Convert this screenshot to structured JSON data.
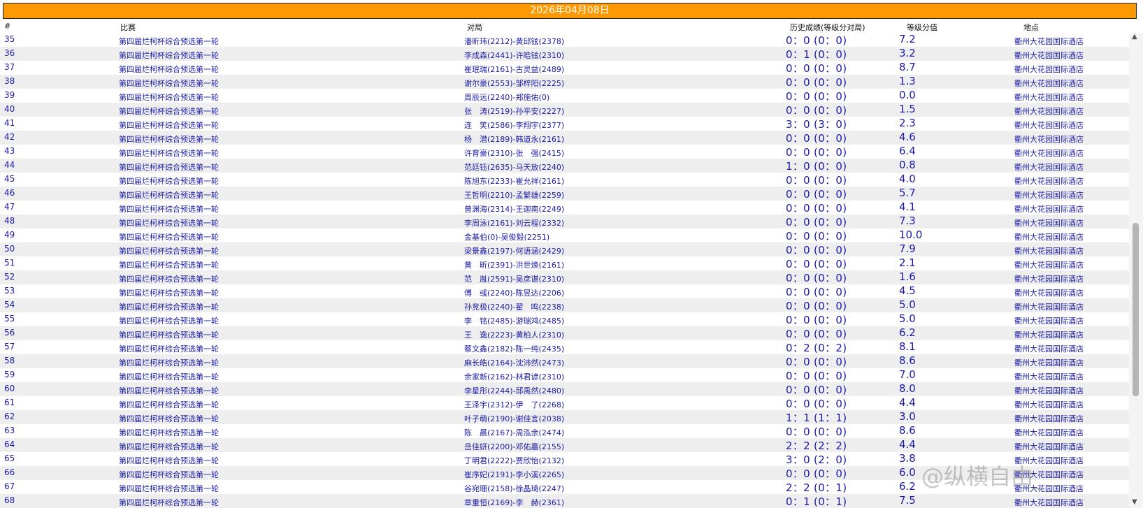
{
  "banner": {
    "date": "2026年04月08日"
  },
  "header": {
    "num": "#",
    "event": "比赛",
    "match": "对局",
    "history": "历史成绩(等级分对局)",
    "level": "等级分值",
    "venue": "地点"
  },
  "rows": [
    {
      "num": "35",
      "event": "第四届烂柯杯综合预选第一轮",
      "match": "潘昕玮(2212)-黄邱铉(2378)",
      "history": "0：0 (0：0)",
      "level": "7.2",
      "venue": "衢州大花园国际酒店"
    },
    {
      "num": "36",
      "event": "第四届烂柯杯综合预选第一轮",
      "match": "李成森(2441)-许皓铉(2310)",
      "history": "0：1 (0：0)",
      "level": "3.2",
      "venue": "衢州大花园国际酒店"
    },
    {
      "num": "37",
      "event": "第四届烂柯杯综合预选第一轮",
      "match": "崔珉瑞(2161)-古灵益(2489)",
      "history": "0：0 (0：0)",
      "level": "8.7",
      "venue": "衢州大花园国际酒店"
    },
    {
      "num": "38",
      "event": "第四届烂柯杯综合预选第一轮",
      "match": "谢尔豪(2553)-邹梓阳(2225)",
      "history": "0：0 (0：0)",
      "level": "1.3",
      "venue": "衢州大花园国际酒店"
    },
    {
      "num": "39",
      "event": "第四届烂柯杯综合预选第一轮",
      "match": "周辰远(2240)-郑施佑(0)",
      "history": "0：0 (0：0)",
      "level": "0.0",
      "venue": "衢州大花园国际酒店"
    },
    {
      "num": "40",
      "event": "第四届烂柯杯综合预选第一轮",
      "match": "张　涛(2519)-孙平安(2227)",
      "history": "0：0 (0：0)",
      "level": "1.5",
      "venue": "衢州大花园国际酒店"
    },
    {
      "num": "41",
      "event": "第四届烂柯杯综合预选第一轮",
      "match": "连　笑(2586)-李翔宇(2377)",
      "history": "3：0 (3：0)",
      "level": "2.3",
      "venue": "衢州大花园国际酒店"
    },
    {
      "num": "42",
      "event": "第四届烂柯杯综合预选第一轮",
      "match": "杨　潜(2189)-韩道永(2161)",
      "history": "0：0 (0：0)",
      "level": "4.6",
      "venue": "衢州大花园国际酒店"
    },
    {
      "num": "43",
      "event": "第四届烂柯杯综合预选第一轮",
      "match": "许育豪(2310)-张　强(2415)",
      "history": "0：0 (0：0)",
      "level": "6.4",
      "venue": "衢州大花园国际酒店"
    },
    {
      "num": "44",
      "event": "第四届烂柯杯综合预选第一轮",
      "match": "范廷钰(2635)-马天放(2240)",
      "history": "1：0 (0：0)",
      "level": "0.8",
      "venue": "衢州大花园国际酒店"
    },
    {
      "num": "45",
      "event": "第四届烂柯杯综合预选第一轮",
      "match": "陈旭东(2233)-崔允祥(2161)",
      "history": "0：0 (0：0)",
      "level": "4.0",
      "venue": "衢州大花园国际酒店"
    },
    {
      "num": "46",
      "event": "第四届烂柯杯综合预选第一轮",
      "match": "王哲明(2210)-孟繁雄(2259)",
      "history": "0：0 (0：0)",
      "level": "5.7",
      "venue": "衢州大花园国际酒店"
    },
    {
      "num": "47",
      "event": "第四届烂柯杯综合预选第一轮",
      "match": "曾渊海(2314)-王迦南(2249)",
      "history": "0：0 (0：0)",
      "level": "4.1",
      "venue": "衢州大花园国际酒店"
    },
    {
      "num": "48",
      "event": "第四届烂柯杯综合预选第一轮",
      "match": "李周泳(2161)-刘云程(2332)",
      "history": "0：0 (0：0)",
      "level": "7.3",
      "venue": "衢州大花园国际酒店"
    },
    {
      "num": "49",
      "event": "第四届烂柯杯综合预选第一轮",
      "match": "金基伯(0)-吴俊毅(2251)",
      "history": "0：0 (0：0)",
      "level": "10.0",
      "venue": "衢州大花园国际酒店"
    },
    {
      "num": "50",
      "event": "第四届烂柯杯综合预选第一轮",
      "match": "梁景鑫(2197)-何语涵(2429)",
      "history": "0：0 (0：0)",
      "level": "7.9",
      "venue": "衢州大花园国际酒店"
    },
    {
      "num": "51",
      "event": "第四届烂柯杯综合预选第一轮",
      "match": "黄　昕(2391)-洪世焕(2161)",
      "history": "0：0 (0：0)",
      "level": "2.1",
      "venue": "衢州大花园国际酒店"
    },
    {
      "num": "52",
      "event": "第四届烂柯杯综合预选第一轮",
      "match": "范　胤(2591)-吴彦谌(2310)",
      "history": "0：0 (0：0)",
      "level": "1.6",
      "venue": "衢州大花园国际酒店"
    },
    {
      "num": "53",
      "event": "第四届烂柯杯综合预选第一轮",
      "match": "傅　彧(2240)-陈昱达(2206)",
      "history": "0：0 (0：0)",
      "level": "4.5",
      "venue": "衢州大花园国际酒店"
    },
    {
      "num": "54",
      "event": "第四届烂柯杯综合预选第一轮",
      "match": "孙竞极(2240)-翟　鸣(2238)",
      "history": "0：0 (0：0)",
      "level": "5.0",
      "venue": "衢州大花园国际酒店"
    },
    {
      "num": "55",
      "event": "第四届烂柯杯综合预选第一轮",
      "match": "李　铭(2485)-游瑞鸿(2485)",
      "history": "0：0 (0：0)",
      "level": "5.0",
      "venue": "衢州大花园国际酒店"
    },
    {
      "num": "56",
      "event": "第四届烂柯杯综合预选第一轮",
      "match": "王　逸(2223)-黄柏人(2310)",
      "history": "0：0 (0：0)",
      "level": "6.2",
      "venue": "衢州大花园国际酒店"
    },
    {
      "num": "57",
      "event": "第四届烂柯杯综合预选第一轮",
      "match": "蔡文鑫(2182)-陈一纯(2435)",
      "history": "0：2 (0：2)",
      "level": "8.1",
      "venue": "衢州大花园国际酒店"
    },
    {
      "num": "58",
      "event": "第四届烂柯杯综合预选第一轮",
      "match": "麻长皓(2164)-沈沛然(2473)",
      "history": "0：0 (0：0)",
      "level": "8.6",
      "venue": "衢州大花园国际酒店"
    },
    {
      "num": "59",
      "event": "第四届烂柯杯综合预选第一轮",
      "match": "余家新(2162)-林君谚(2310)",
      "history": "0：0 (0：0)",
      "level": "7.0",
      "venue": "衢州大花园国际酒店"
    },
    {
      "num": "60",
      "event": "第四届烂柯杯综合预选第一轮",
      "match": "李星彤(2244)-邱禹然(2480)",
      "history": "0：0 (0：0)",
      "level": "8.0",
      "venue": "衢州大花园国际酒店"
    },
    {
      "num": "61",
      "event": "第四届烂柯杯综合预选第一轮",
      "match": "王泽宇(2312)-伊　了(2268)",
      "history": "0：0 (0：0)",
      "level": "4.4",
      "venue": "衢州大花园国际酒店"
    },
    {
      "num": "62",
      "event": "第四届烂柯杯综合预选第一轮",
      "match": "叶子萌(2190)-谢佳言(2038)",
      "history": "1：1 (1：1)",
      "level": "3.0",
      "venue": "衢州大花园国际酒店"
    },
    {
      "num": "63",
      "event": "第四届烂柯杯综合预选第一轮",
      "match": "陈　晨(2167)-周泓余(2474)",
      "history": "0：0 (0：0)",
      "level": "8.6",
      "venue": "衢州大花园国际酒店"
    },
    {
      "num": "64",
      "event": "第四届烂柯杯综合预选第一轮",
      "match": "岳佳妍(2200)-邓佑嘉(2155)",
      "history": "2：2 (2：2)",
      "level": "4.4",
      "venue": "衢州大花园国际酒店"
    },
    {
      "num": "65",
      "event": "第四届烂柯杯综合预选第一轮",
      "match": "丁明君(2222)-贾欣怡(2132)",
      "history": "3：0 (2：0)",
      "level": "3.8",
      "venue": "衢州大花园国际酒店"
    },
    {
      "num": "66",
      "event": "第四届烂柯杯综合预选第一轮",
      "match": "崔序妃(2191)-李小溪(2265)",
      "history": "0：0 (0：0)",
      "level": "6.0",
      "venue": "衢州大花园国际酒店"
    },
    {
      "num": "67",
      "event": "第四届烂柯杯综合预选第一轮",
      "match": "谷宛珊(2158)-徐晶琦(2247)",
      "history": "2：2 (0：1)",
      "level": "6.2",
      "venue": "衢州大花园国际酒店"
    },
    {
      "num": "68",
      "event": "第四届烂柯杯综合预选第一轮",
      "match": "章重恒(2169)-李　赫(2361)",
      "history": "0：1 (0：1)",
      "level": "7.5",
      "venue": "衢州大花园国际酒店"
    }
  ],
  "scrollbar": {
    "up_icon": "▲",
    "down_icon": "▼"
  },
  "watermark": {
    "text": "@纵横自由_"
  }
}
